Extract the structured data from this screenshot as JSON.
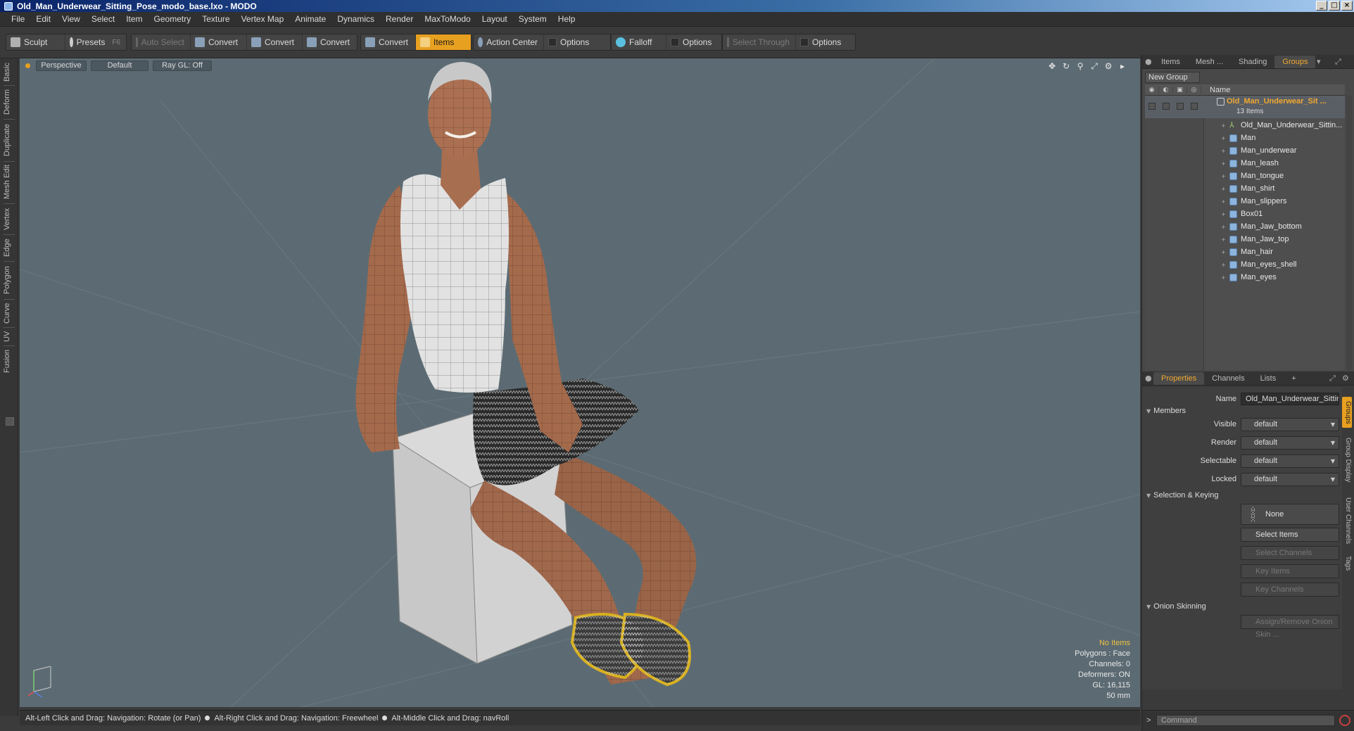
{
  "window": {
    "title": "Old_Man_Underwear_Sitting_Pose_modo_base.lxo - MODO",
    "controls": [
      "_",
      "□",
      "×"
    ]
  },
  "menu": [
    "File",
    "Edit",
    "View",
    "Select",
    "Item",
    "Geometry",
    "Texture",
    "Vertex Map",
    "Animate",
    "Dynamics",
    "Render",
    "MaxToModo",
    "Layout",
    "System",
    "Help"
  ],
  "toolbar": {
    "sculpt": "Sculpt",
    "presets": "Presets",
    "presets_key": "F6",
    "auto_select": "Auto Select",
    "convert": "Convert",
    "items": "Items",
    "action_center": "Action Center",
    "options": "Options",
    "falloff": "Falloff",
    "select_through": "Select Through"
  },
  "left_tabs": [
    "Basic",
    "Deform",
    "Duplicate",
    "Mesh Edit",
    "Vertex",
    "Edge",
    "Polygon",
    "Curve",
    "UV",
    "Fusion"
  ],
  "viewport": {
    "view": "Perspective",
    "shading": "Default",
    "raygl": "Ray GL: Off",
    "nav_icons": [
      "✥",
      "↻",
      "⚲",
      "⤢",
      "⚙",
      "▸"
    ],
    "info": {
      "selection": "No Items",
      "polygons": "Polygons : Face",
      "channels": "Channels: 0",
      "deformers": "Deformers: ON",
      "gl": "GL: 16,115",
      "focal": "50 mm"
    }
  },
  "status": {
    "hint1": "Alt-Left Click and Drag: Navigation: Rotate (or Pan)",
    "hint2": "Alt-Right Click and Drag: Navigation: Freewheel",
    "hint3": "Alt-Middle Click and Drag: navRoll"
  },
  "top_tabs": [
    "Items",
    "Mesh ...",
    "Shading",
    "Groups"
  ],
  "groups": {
    "new_group": "New Group",
    "name_col": "Name",
    "root_name": "Old_Man_Underwear_Sit ...",
    "root_count": "13 Items",
    "items": [
      "Old_Man_Underwear_Sittin...",
      "Man",
      "Man_underwear",
      "Man_leash",
      "Man_tongue",
      "Man_shirt",
      "Man_slippers",
      "Box01",
      "Man_Jaw_bottom",
      "Man_Jaw_top",
      "Man_hair",
      "Man_eyes_shell",
      "Man_eyes"
    ]
  },
  "bottom_tabs": [
    "Properties",
    "Channels",
    "Lists",
    "+"
  ],
  "properties": {
    "name_label": "Name",
    "name_value": "Old_Man_Underwear_Sitting_Pose",
    "members": "Members",
    "visible_label": "Visible",
    "render_label": "Render",
    "selectable_label": "Selectable",
    "locked_label": "Locked",
    "default_value": "default",
    "selection_keying": "Selection & Keying",
    "none": "None",
    "select_items": "Select Items",
    "select_channels": "Select Channels",
    "key_items": "Key Items",
    "key_channels": "Key Channels",
    "onion": "Onion Skinning",
    "assign_onion": "Assign/Remove Onion Skin ..."
  },
  "side_tabs": [
    "Groups",
    "Group Display",
    "User Channels",
    "Tags"
  ],
  "command": {
    "prompt": ">",
    "placeholder": "Command"
  }
}
